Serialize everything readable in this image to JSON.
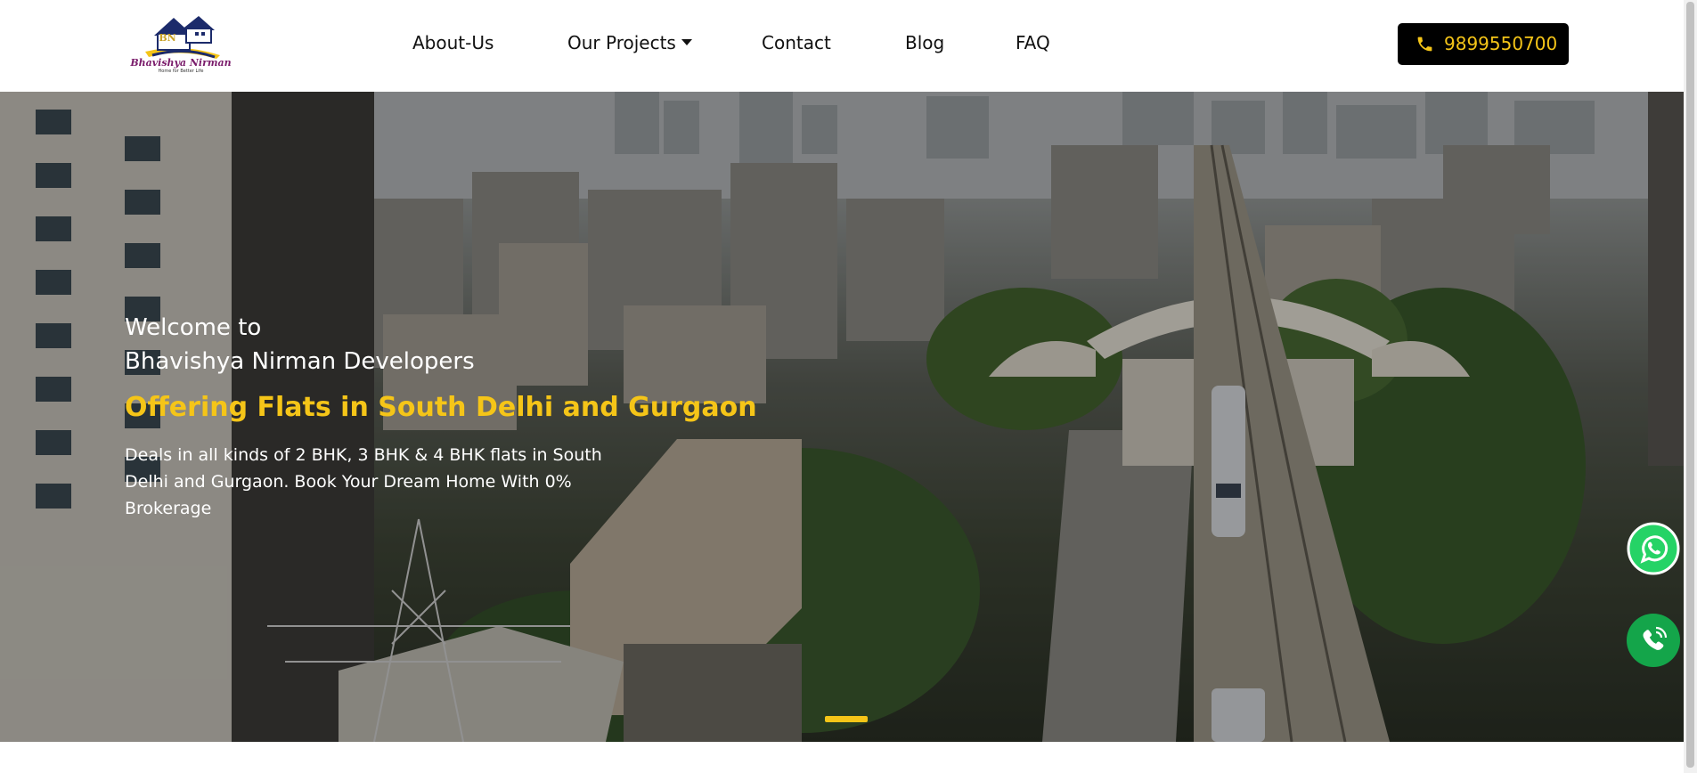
{
  "brand": {
    "name": "Bhavishya Nirman",
    "tagline": "Home for Better Life",
    "monogram": "BN",
    "accent_color": "#f5c518"
  },
  "nav": {
    "items": [
      {
        "label": "About-Us"
      },
      {
        "label": "Our Projects"
      },
      {
        "label": "Contact"
      },
      {
        "label": "Blog"
      },
      {
        "label": "FAQ"
      }
    ]
  },
  "phone": {
    "number": "9899550700",
    "icon": "phone-icon"
  },
  "hero": {
    "welcome_line1": "Welcome to",
    "welcome_line2": "Bhavishya Nirman Developers",
    "headline": "Offering Flats in South Delhi and Gurgaon",
    "description": "Deals in all kinds of 2 BHK, 3 BHK & 4 BHK flats in South Delhi and Gurgaon. Book Your Dream Home With 0% Brokerage"
  },
  "floating": {
    "whatsapp_icon": "whatsapp-icon",
    "call_icon": "phone-call-icon",
    "whatsapp_color": "#25d366",
    "call_color": "#14a54a"
  }
}
